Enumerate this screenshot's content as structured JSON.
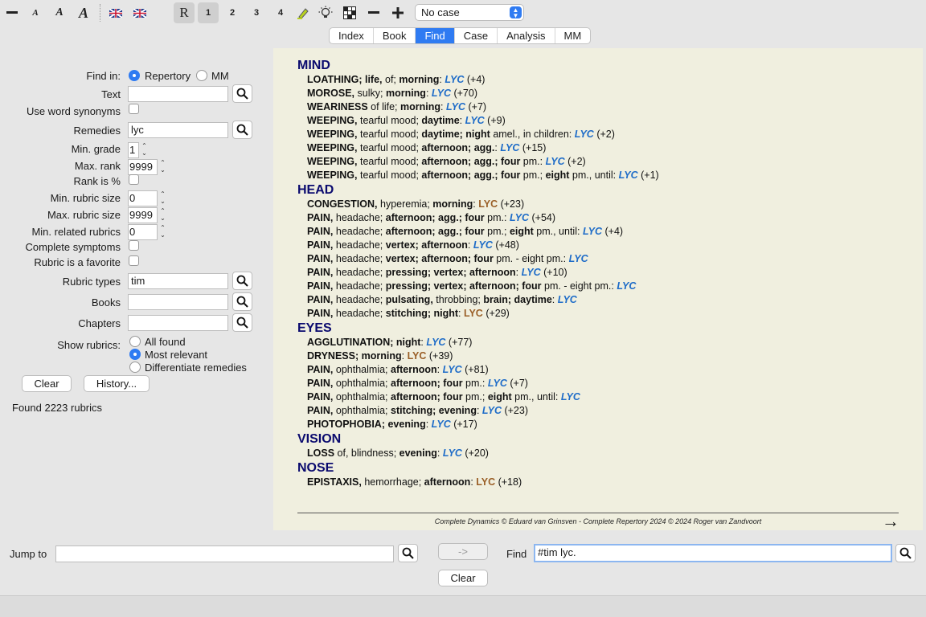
{
  "toolbar": {
    "buttons": [
      "minus-icon",
      "font-small-icon",
      "font-medium-icon",
      "font-large-icon",
      "flag-uk-icon",
      "flag-uk-icon"
    ],
    "r_label": "R",
    "grade_buttons": [
      "1",
      "2",
      "3",
      "4"
    ],
    "case_select": "No case"
  },
  "tabs": [
    "Index",
    "Book",
    "Find",
    "Case",
    "Analysis",
    "MM"
  ],
  "form": {
    "find_in_label": "Find in:",
    "repertory_label": "Repertory",
    "mm_label": "MM",
    "text_label": "Text",
    "text_value": "",
    "synonyms_label": "Use word synonyms",
    "remedies_label": "Remedies",
    "remedies_value": "lyc",
    "min_grade_label": "Min. grade",
    "min_grade_value": "1",
    "max_rank_label": "Max. rank",
    "max_rank_value": "9999",
    "rank_pct_label": "Rank is %",
    "min_rubric_label": "Min. rubric size",
    "min_rubric_value": "0",
    "max_rubric_label": "Max. rubric size",
    "max_rubric_value": "9999",
    "min_related_label": "Min. related rubrics",
    "min_related_value": "0",
    "complete_label": "Complete symptoms",
    "favorite_label": "Rubric is a favorite",
    "rubric_types_label": "Rubric types",
    "rubric_types_value": "tim",
    "books_label": "Books",
    "chapters_label": "Chapters",
    "show_rubrics_label": "Show rubrics:",
    "opt_all": "All found",
    "opt_relevant": "Most relevant",
    "opt_diff": "Differentiate remedies",
    "clear_label": "Clear",
    "history_label": "History...",
    "found_text": "Found 2223 rubrics"
  },
  "results": [
    {
      "chapter": "MIND",
      "rubrics": [
        {
          "text": "<b>LOATHING; life,</b> of; <b>morning</b>: ",
          "remedy": "LYC",
          "style": "blue",
          "count": "(+4)"
        },
        {
          "text": "<b>MOROSE,</b> sulky; <b>morning</b>: ",
          "remedy": "LYC",
          "style": "blue",
          "count": "(+70)"
        },
        {
          "text": "<b>WEARINESS</b> of life; <b>morning</b>: ",
          "remedy": "LYC",
          "style": "blue",
          "count": "(+7)"
        },
        {
          "text": "<b>WEEPING,</b> tearful mood; <b>daytime</b>: ",
          "remedy": "LYC",
          "style": "blue",
          "count": "(+9)"
        },
        {
          "text": "<b>WEEPING,</b> tearful mood; <b>daytime; night</b> amel., in children: ",
          "remedy": "LYC",
          "style": "blue",
          "count": "(+2)"
        },
        {
          "text": "<b>WEEPING,</b> tearful mood; <b>afternoon; agg.</b>: ",
          "remedy": "LYC",
          "style": "blue",
          "count": "(+15)"
        },
        {
          "text": "<b>WEEPING,</b> tearful mood; <b>afternoon; agg.; four</b> pm.: ",
          "remedy": "LYC",
          "style": "blue",
          "count": "(+2)"
        },
        {
          "text": "<b>WEEPING,</b> tearful mood; <b>afternoon; agg.; four</b> pm.; <b>eight</b> pm., until: ",
          "remedy": "LYC",
          "style": "blue",
          "count": "(+1)"
        }
      ]
    },
    {
      "chapter": "HEAD",
      "rubrics": [
        {
          "text": "<b>CONGESTION,</b> hyperemia; <b>morning</b>: ",
          "remedy": "LYC",
          "style": "brown",
          "count": "(+23)"
        },
        {
          "text": "<b>PAIN,</b> headache; <b>afternoon; agg.; four</b> pm.: ",
          "remedy": "LYC",
          "style": "blue",
          "count": "(+54)"
        },
        {
          "text": "<b>PAIN,</b> headache; <b>afternoon; agg.; four</b> pm.; <b>eight</b> pm., until: ",
          "remedy": "LYC",
          "style": "blue",
          "count": "(+4)"
        },
        {
          "text": "<b>PAIN,</b> headache; <b>vertex; afternoon</b>: ",
          "remedy": "LYC",
          "style": "blue",
          "count": "(+48)"
        },
        {
          "text": "<b>PAIN,</b> headache; <b>vertex; afternoon; four</b> pm. - eight pm.: ",
          "remedy": "LYC",
          "style": "blue",
          "count": ""
        },
        {
          "text": "<b>PAIN,</b> headache; <b>pressing; vertex; afternoon</b>: ",
          "remedy": "LYC",
          "style": "blue",
          "count": "(+10)"
        },
        {
          "text": "<b>PAIN,</b> headache; <b>pressing; vertex; afternoon; four</b> pm. - eight pm.: ",
          "remedy": "LYC",
          "style": "blue",
          "count": ""
        },
        {
          "text": "<b>PAIN,</b> headache; <b>pulsating,</b> throbbing; <b>brain; daytime</b>: ",
          "remedy": "LYC",
          "style": "blue",
          "count": ""
        },
        {
          "text": "<b>PAIN,</b> headache; <b>stitching; night</b>: ",
          "remedy": "LYC",
          "style": "brown",
          "count": "(+29)"
        }
      ]
    },
    {
      "chapter": "EYES",
      "rubrics": [
        {
          "text": "<b>AGGLUTINATION; night</b>: ",
          "remedy": "LYC",
          "style": "blue",
          "count": "(+77)"
        },
        {
          "text": "<b>DRYNESS; morning</b>: ",
          "remedy": "LYC",
          "style": "brown",
          "count": "(+39)"
        },
        {
          "text": "<b>PAIN,</b> ophthalmia; <b>afternoon</b>: ",
          "remedy": "LYC",
          "style": "blue",
          "count": "(+81)"
        },
        {
          "text": "<b>PAIN,</b> ophthalmia; <b>afternoon; four</b> pm.: ",
          "remedy": "LYC",
          "style": "blue",
          "count": "(+7)"
        },
        {
          "text": "<b>PAIN,</b> ophthalmia; <b>afternoon; four</b> pm.; <b>eight</b> pm., until: ",
          "remedy": "LYC",
          "style": "blue",
          "count": ""
        },
        {
          "text": "<b>PAIN,</b> ophthalmia; <b>stitching; evening</b>: ",
          "remedy": "LYC",
          "style": "blue",
          "count": "(+23)"
        },
        {
          "text": "<b>PHOTOPHOBIA; evening</b>: ",
          "remedy": "LYC",
          "style": "blue",
          "count": "(+17)"
        }
      ]
    },
    {
      "chapter": "VISION",
      "rubrics": [
        {
          "text": "<b>LOSS</b> of, blindness; <b>evening</b>: ",
          "remedy": "LYC",
          "style": "blue",
          "count": "(+20)"
        }
      ]
    },
    {
      "chapter": "NOSE",
      "rubrics": [
        {
          "text": "<b>EPISTAXIS,</b> hemorrhage; <b>afternoon</b>: ",
          "remedy": "LYC",
          "style": "brown",
          "count": "(+18)"
        }
      ]
    }
  ],
  "footer": "Complete Dynamics © Eduard van Grinsven  -  Complete Repertory 2024 © 2024 Roger van Zandvoort",
  "bottom": {
    "jump_label": "Jump to",
    "jump_value": "",
    "arrow_label": "->",
    "find_label": "Find",
    "find_value": "#tim lyc.",
    "clear_label": "Clear"
  }
}
